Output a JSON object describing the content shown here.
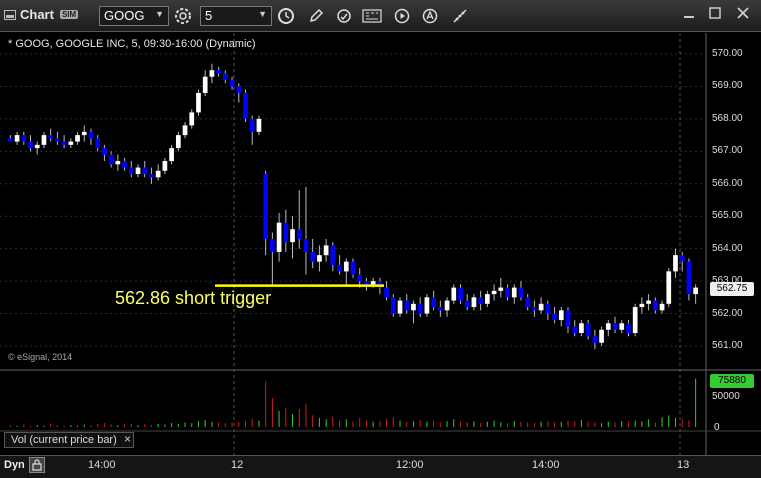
{
  "toolbar": {
    "app_title": "Chart",
    "sim_badge": "SIM",
    "symbol_value": "GOOG",
    "interval_value": "5"
  },
  "chart": {
    "title": "* GOOG, GOOGLE INC, 5, 09:30-16:00 (Dynamic)",
    "copyright": "© eSignal, 2014",
    "annotation": "562.86 short trigger",
    "trigger_price": 562.86,
    "last_price_tag": "562.75",
    "y_axis_labels": [
      "570.00",
      "569.00",
      "568.00",
      "567.00",
      "566.00",
      "565.00",
      "564.00",
      "563.00",
      "562.00",
      "561.00"
    ],
    "x_axis_labels": [
      "14:00",
      "12",
      "12:00",
      "14:00",
      "13"
    ]
  },
  "volume": {
    "label": "Vol (current price bar)",
    "last_value_tag": "75880",
    "y_axis_labels": [
      "50000",
      "0"
    ]
  },
  "bottom": {
    "dyn_label": "Dyn"
  },
  "colors": {
    "up": "#ffffff",
    "down": "#0000ff",
    "trigger_line": "#ffff00",
    "vol_up": "#33cc33",
    "vol_down": "#cc2222"
  },
  "chart_data": {
    "type": "candlestick",
    "y_range": [
      560.7,
      570.5
    ],
    "candles": [
      [
        567.4,
        567.5,
        567.3,
        567.3
      ],
      [
        567.3,
        567.6,
        567.2,
        567.5
      ],
      [
        567.5,
        567.6,
        567.2,
        567.3
      ],
      [
        567.3,
        567.5,
        567.0,
        567.1
      ],
      [
        567.1,
        567.3,
        566.9,
        567.2
      ],
      [
        567.2,
        567.6,
        567.1,
        567.5
      ],
      [
        567.5,
        567.7,
        567.3,
        567.4
      ],
      [
        567.4,
        567.6,
        567.2,
        567.3
      ],
      [
        567.3,
        567.5,
        567.1,
        567.2
      ],
      [
        567.2,
        567.4,
        567.1,
        567.3
      ],
      [
        567.3,
        567.6,
        567.2,
        567.5
      ],
      [
        567.5,
        567.8,
        567.3,
        567.6
      ],
      [
        567.6,
        567.7,
        567.2,
        567.4
      ],
      [
        567.4,
        567.5,
        567.0,
        567.1
      ],
      [
        567.1,
        567.2,
        566.7,
        566.9
      ],
      [
        566.9,
        567.0,
        566.5,
        566.6
      ],
      [
        566.6,
        566.9,
        566.4,
        566.7
      ],
      [
        566.7,
        566.8,
        566.4,
        566.5
      ],
      [
        566.5,
        566.7,
        566.2,
        566.3
      ],
      [
        566.3,
        566.6,
        566.2,
        566.5
      ],
      [
        566.5,
        566.7,
        566.2,
        566.3
      ],
      [
        566.3,
        566.5,
        566.0,
        566.2
      ],
      [
        566.2,
        566.6,
        566.1,
        566.4
      ],
      [
        566.4,
        566.8,
        566.3,
        566.7
      ],
      [
        566.7,
        567.2,
        566.6,
        567.1
      ],
      [
        567.1,
        567.6,
        567.0,
        567.5
      ],
      [
        567.5,
        567.9,
        567.4,
        567.8
      ],
      [
        567.8,
        568.3,
        567.7,
        568.2
      ],
      [
        568.2,
        568.9,
        568.1,
        568.8
      ],
      [
        568.8,
        569.5,
        568.7,
        569.3
      ],
      [
        569.3,
        569.7,
        569.1,
        569.5
      ],
      [
        569.5,
        569.6,
        569.3,
        569.4
      ],
      [
        569.4,
        569.5,
        569.1,
        569.2
      ],
      [
        569.2,
        569.3,
        568.9,
        569.0
      ],
      [
        569.0,
        569.1,
        568.5,
        568.8
      ],
      [
        568.8,
        568.9,
        567.9,
        568.0
      ],
      [
        568.0,
        568.1,
        567.2,
        567.6
      ],
      [
        567.6,
        568.1,
        567.5,
        568.0
      ],
      [
        566.3,
        566.4,
        563.8,
        564.3
      ],
      [
        564.3,
        564.5,
        562.9,
        563.9
      ],
      [
        563.9,
        565.1,
        563.6,
        564.8
      ],
      [
        564.8,
        565.2,
        563.9,
        564.2
      ],
      [
        564.2,
        565.0,
        563.7,
        564.6
      ],
      [
        564.6,
        565.8,
        564.0,
        564.3
      ],
      [
        564.3,
        565.9,
        563.2,
        563.9
      ],
      [
        563.9,
        564.3,
        563.4,
        563.6
      ],
      [
        563.6,
        564.1,
        563.3,
        563.8
      ],
      [
        563.8,
        564.3,
        563.6,
        564.1
      ],
      [
        564.1,
        564.2,
        563.3,
        563.5
      ],
      [
        563.5,
        563.8,
        563.2,
        563.3
      ],
      [
        563.3,
        563.7,
        562.9,
        563.6
      ],
      [
        563.6,
        563.7,
        563.1,
        563.2
      ],
      [
        563.2,
        563.4,
        562.8,
        563.0
      ],
      [
        563.0,
        563.1,
        562.7,
        562.9
      ],
      [
        562.9,
        563.1,
        562.8,
        563.0
      ],
      [
        563.0,
        563.1,
        562.6,
        562.8
      ],
      [
        562.8,
        563.0,
        562.4,
        562.5
      ],
      [
        562.5,
        562.6,
        561.9,
        562.0
      ],
      [
        562.0,
        562.5,
        561.9,
        562.4
      ],
      [
        562.4,
        562.6,
        562.0,
        562.1
      ],
      [
        562.1,
        562.4,
        561.7,
        562.3
      ],
      [
        562.3,
        562.5,
        561.9,
        562.0
      ],
      [
        562.0,
        562.6,
        561.9,
        562.5
      ],
      [
        562.5,
        562.7,
        562.1,
        562.2
      ],
      [
        562.2,
        562.4,
        561.9,
        562.1
      ],
      [
        562.1,
        562.5,
        561.9,
        562.4
      ],
      [
        562.4,
        562.9,
        562.3,
        562.8
      ],
      [
        562.8,
        562.9,
        562.3,
        562.4
      ],
      [
        562.4,
        562.6,
        562.1,
        562.2
      ],
      [
        562.2,
        562.6,
        562.1,
        562.5
      ],
      [
        562.5,
        562.7,
        562.1,
        562.3
      ],
      [
        562.3,
        562.7,
        562.2,
        562.6
      ],
      [
        562.6,
        562.9,
        562.4,
        562.7
      ],
      [
        562.7,
        563.1,
        562.5,
        562.8
      ],
      [
        562.8,
        562.9,
        562.4,
        562.5
      ],
      [
        562.5,
        562.9,
        562.3,
        562.8
      ],
      [
        562.8,
        563.0,
        562.4,
        562.5
      ],
      [
        562.5,
        562.6,
        562.1,
        562.2
      ],
      [
        562.2,
        562.4,
        561.9,
        562.1
      ],
      [
        562.1,
        562.5,
        562.0,
        562.3
      ],
      [
        562.3,
        562.4,
        561.8,
        562.0
      ],
      [
        562.0,
        562.2,
        561.7,
        561.8
      ],
      [
        561.8,
        562.2,
        561.6,
        562.1
      ],
      [
        562.1,
        562.2,
        561.4,
        561.6
      ],
      [
        561.6,
        561.8,
        561.3,
        561.4
      ],
      [
        561.4,
        561.8,
        561.3,
        561.7
      ],
      [
        561.7,
        561.8,
        561.2,
        561.3
      ],
      [
        561.3,
        561.5,
        560.9,
        561.1
      ],
      [
        561.1,
        561.6,
        561.0,
        561.5
      ],
      [
        561.5,
        561.8,
        561.3,
        561.7
      ],
      [
        561.7,
        561.9,
        561.4,
        561.5
      ],
      [
        561.5,
        561.8,
        561.4,
        561.7
      ],
      [
        561.7,
        561.8,
        561.3,
        561.4
      ],
      [
        561.4,
        562.3,
        561.3,
        562.2
      ],
      [
        562.2,
        562.5,
        562.0,
        562.3
      ],
      [
        562.3,
        562.6,
        562.1,
        562.4
      ],
      [
        562.4,
        562.5,
        562.0,
        562.1
      ],
      [
        562.1,
        562.4,
        562.0,
        562.3
      ],
      [
        562.3,
        563.4,
        562.2,
        563.3
      ],
      [
        563.3,
        564.0,
        563.1,
        563.8
      ],
      [
        563.8,
        563.9,
        563.3,
        563.6
      ],
      [
        563.6,
        563.7,
        562.4,
        562.6
      ],
      [
        562.6,
        562.9,
        562.3,
        562.8
      ]
    ],
    "volume": [
      3,
      2,
      4,
      2,
      3,
      2,
      5,
      3,
      2,
      3,
      2,
      4,
      3,
      5,
      6,
      4,
      3,
      4,
      5,
      3,
      4,
      3,
      5,
      4,
      6,
      5,
      7,
      6,
      9,
      11,
      8,
      7,
      6,
      7,
      8,
      9,
      12,
      10,
      70,
      45,
      25,
      30,
      20,
      28,
      35,
      18,
      14,
      12,
      16,
      10,
      12,
      9,
      14,
      10,
      8,
      9,
      12,
      15,
      10,
      8,
      9,
      11,
      8,
      10,
      7,
      9,
      12,
      8,
      7,
      9,
      6,
      8,
      10,
      7,
      6,
      9,
      8,
      7,
      6,
      8,
      9,
      7,
      8,
      10,
      9,
      11,
      8,
      7,
      6,
      8,
      7,
      9,
      8,
      10,
      9,
      12,
      7,
      15,
      18,
      14,
      12,
      10,
      75,
      20
    ]
  }
}
